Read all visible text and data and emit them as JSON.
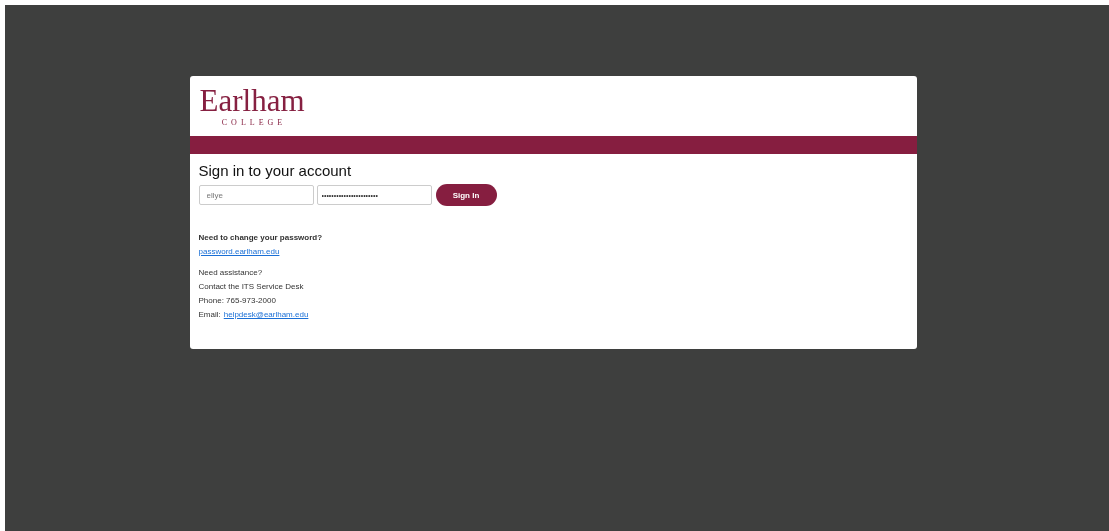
{
  "logo": {
    "name": "Earlham",
    "subtitle": "COLLEGE"
  },
  "form": {
    "title": "Sign in to your account",
    "username": {
      "value": "ellye"
    },
    "password": {
      "value": "•••••••••••••••••••••••"
    },
    "submit": "Sign In"
  },
  "password_help": {
    "heading": "Need to change your password?",
    "link": "password.earlham.edu"
  },
  "assistance": [
    {
      "kind": "text",
      "text": "Need assistance?"
    },
    {
      "kind": "text",
      "text": "Contact the ITS Service Desk"
    },
    {
      "kind": "text",
      "text": "Phone: 765-973-2000"
    },
    {
      "kind": "link",
      "label": "Email:",
      "text": "helpdesk@earlham.edu"
    }
  ]
}
